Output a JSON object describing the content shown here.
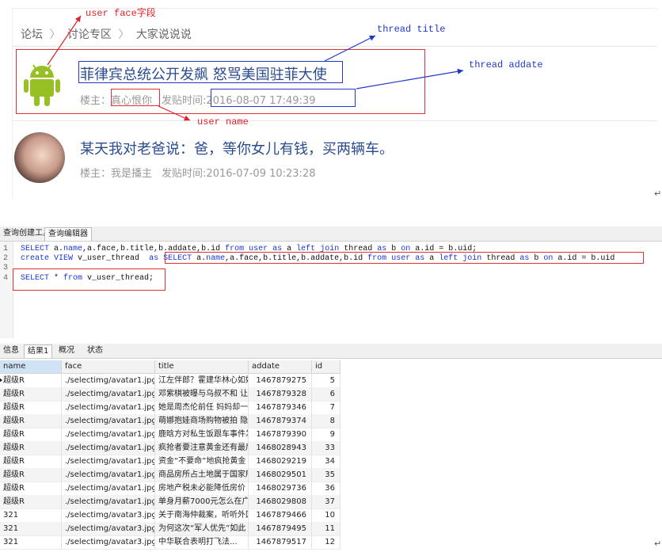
{
  "forum": {
    "breadcrumb": [
      "论坛",
      "讨论专区",
      "大家说说说"
    ],
    "breadcrumb_sep": "〉",
    "threads": [
      {
        "title": "菲律宾总统公开发飙 怒骂美国驻菲大使",
        "author_label": "楼主：",
        "author": "真心恨你",
        "date_label": "发贴时间:",
        "date": "2016-08-07 17:49:39",
        "avatar": "android-icon"
      },
      {
        "title": "某天我对老爸说：爸，等你女儿有钱，买两辆车。",
        "author_label": "楼主：",
        "author": "我是播主",
        "date_label": "发贴时间:",
        "date": "2016-07-09 10:23:28",
        "avatar": "user-photo"
      }
    ],
    "annotations": {
      "user_face": "user face字段",
      "thread_title": "thread title",
      "thread_addate": "thread addate",
      "user_name": "user name"
    },
    "paragraph_mark": "↵"
  },
  "editor": {
    "tabs": [
      "查询创建工具",
      "查询编辑器"
    ],
    "lines": [
      {
        "num": "1",
        "parts": [
          [
            "kw",
            "SELECT"
          ],
          [
            "t",
            " a."
          ],
          [
            "kw",
            "name"
          ],
          [
            "t",
            ",a.face,b.title,b.addate,b.id "
          ],
          [
            "kw",
            "from"
          ],
          [
            "t",
            " "
          ],
          [
            "kw",
            "user"
          ],
          [
            "t",
            " "
          ],
          [
            "kw",
            "as"
          ],
          [
            "t",
            " a "
          ],
          [
            "kw",
            "left"
          ],
          [
            "t",
            " "
          ],
          [
            "kw",
            "join"
          ],
          [
            "t",
            " thread "
          ],
          [
            "kw",
            "as"
          ],
          [
            "t",
            " b "
          ],
          [
            "kw",
            "on"
          ],
          [
            "t",
            " a.id = b.uid;"
          ]
        ]
      },
      {
        "num": "2",
        "parts": [
          [
            "kw",
            "create"
          ],
          [
            "t",
            " "
          ],
          [
            "kw",
            "VIEW"
          ],
          [
            "t",
            " v_user_thread  "
          ],
          [
            "kw",
            "as"
          ],
          [
            "t",
            " "
          ],
          [
            "kw",
            "SELECT"
          ],
          [
            "t",
            " a."
          ],
          [
            "kw",
            "name"
          ],
          [
            "t",
            ",a.face,b.title,b.addate,b.id "
          ],
          [
            "kw",
            "from"
          ],
          [
            "t",
            " "
          ],
          [
            "kw",
            "user"
          ],
          [
            "t",
            " "
          ],
          [
            "kw",
            "as"
          ],
          [
            "t",
            " a "
          ],
          [
            "kw",
            "left"
          ],
          [
            "t",
            " "
          ],
          [
            "kw",
            "join"
          ],
          [
            "t",
            " thread "
          ],
          [
            "kw",
            "as"
          ],
          [
            "t",
            " b "
          ],
          [
            "kw",
            "on"
          ],
          [
            "t",
            " a.id = b.uid"
          ]
        ]
      },
      {
        "num": "3",
        "parts": []
      },
      {
        "num": "4",
        "parts": [
          [
            "kw",
            "SELECT"
          ],
          [
            "t",
            " * "
          ],
          [
            "kw",
            "from"
          ],
          [
            "t",
            " v_user_thread;"
          ]
        ]
      }
    ]
  },
  "results": {
    "tabs": [
      "信息",
      "结果1",
      "概况",
      "状态"
    ],
    "active_tab": "结果1",
    "columns": [
      "name",
      "face",
      "title",
      "addate",
      "id"
    ],
    "rows": [
      [
        "超级R",
        "./selectimg/avatar1.jpg",
        "江左伴郎？霍建华林心如婚",
        "1467879275",
        "5"
      ],
      [
        "超级R",
        "./selectimg/avatar1.jpg",
        "邓紫棋被曝与乌叔不和 让房",
        "1467879328",
        "6"
      ],
      [
        "超级R",
        "./selectimg/avatar1.jpg",
        "她是周杰伦前任 妈妈却一生",
        "1467879346",
        "7"
      ],
      [
        "超级R",
        "./selectimg/avatar1.jpg",
        "萌娜抱娃商场购物被拍 隐婚",
        "1467879374",
        "8"
      ],
      [
        "超级R",
        "./selectimg/avatar1.jpg",
        "鹿晗方对私生饭跟车事件发",
        "1467879390",
        "9"
      ],
      [
        "超级R",
        "./selectimg/avatar1.jpg",
        "疯抢者要注意黄金还有最后",
        "1468028943",
        "33"
      ],
      [
        "超级R",
        "./selectimg/avatar1.jpg",
        "资金“不要命”地疯抢黄金",
        "1468029219",
        "34"
      ],
      [
        "超级R",
        "./selectimg/avatar1.jpg",
        "商品房所占土地属于国家所",
        "1468029501",
        "35"
      ],
      [
        "超级R",
        "./selectimg/avatar1.jpg",
        "房地产税未必能降低房价",
        "1468029736",
        "36"
      ],
      [
        "超级R",
        "./selectimg/avatar1.jpg",
        "单身月薪7000元怎么在广州",
        "1468029808",
        "37"
      ],
      [
        "321",
        "./selectimg/avatar3.jpg",
        "关于南海仲裁案，听听外国",
        "1467879466",
        "10"
      ],
      [
        "321",
        "./selectimg/avatar3.jpg",
        "为何这次“军人优先”如此",
        "1467879495",
        "11"
      ],
      [
        "321",
        "./selectimg/avatar3.jpg",
        "中华联合表明打飞法...",
        "1467879517",
        "12"
      ]
    ]
  }
}
